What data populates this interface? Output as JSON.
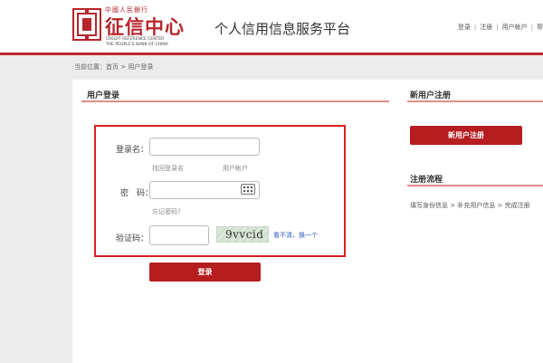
{
  "header": {
    "logo_top": "中國人民銀行",
    "logo_main": "征信中心",
    "logo_en_line1": "CREDIT REFERENCE CENTER",
    "logo_en_line2": "THE PEOPLE'S BANK OF CHINA",
    "platform_title": "个人信用信息服务平台",
    "nav": [
      "登录",
      "注册",
      "用户帐户",
      "帮"
    ]
  },
  "breadcrumb": "当前位置：首页 > 用户登录",
  "login": {
    "section_title": "用户登录",
    "username_label": "登录名：",
    "username_value": "",
    "find_login_name": "找回登录名",
    "user_account": "用户帐户",
    "password_label": "密　码：",
    "password_value": "",
    "forgot_password": "忘记密码？",
    "captcha_label": "验证码：",
    "captcha_value": "",
    "captcha_text": "9vvcid",
    "refresh_captcha": "看不清，换一个",
    "submit_label": "登录"
  },
  "register": {
    "section_title": "新用户注册",
    "button_label": "新用户注册"
  },
  "flow": {
    "section_title": "注册流程",
    "steps_text": "填写身份信息 > 补充用户信息 > 完成注册"
  },
  "colors": {
    "brand_red": "#b51d1f",
    "highlight_border": "#d82020",
    "link_blue": "#2d5db8"
  }
}
